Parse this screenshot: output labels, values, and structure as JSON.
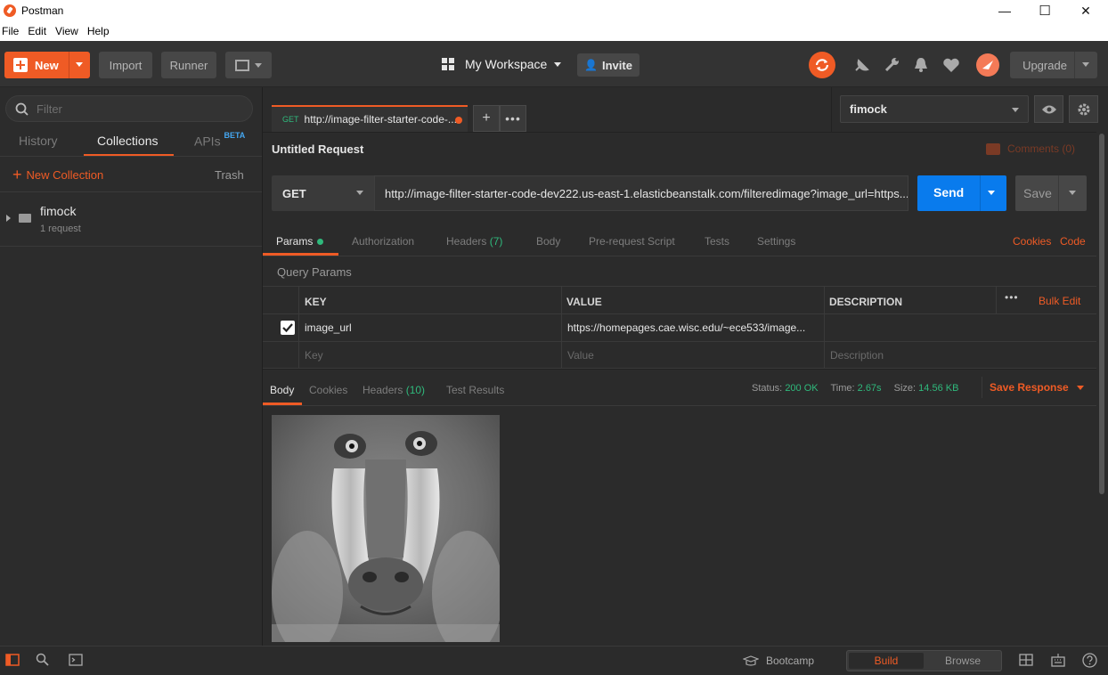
{
  "window": {
    "title": "Postman",
    "minimize": "—",
    "maximize": "☐",
    "close": "✕"
  },
  "menu": [
    "File",
    "Edit",
    "View",
    "Help"
  ],
  "header": {
    "new_label": "New",
    "import_label": "Import",
    "runner_label": "Runner",
    "workspace_label": "My Workspace",
    "invite_label": "Invite",
    "upgrade_label": "Upgrade"
  },
  "sidebar": {
    "filter_placeholder": "Filter",
    "tabs": {
      "history": "History",
      "collections": "Collections",
      "apis": "APIs",
      "apis_badge": "BETA"
    },
    "new_collection": "New Collection",
    "trash": "Trash",
    "collection": {
      "name": "fimock",
      "meta": "1 request"
    }
  },
  "request_tab": {
    "method": "GET",
    "label": "http://image-filter-starter-code-..."
  },
  "environment": {
    "selected": "fimock"
  },
  "request": {
    "name": "Untitled Request",
    "comments": "Comments (0)",
    "method": "GET",
    "url": "http://image-filter-starter-code-dev222.us-east-1.elasticbeanstalk.com/filteredimage?image_url=https...",
    "send": "Send",
    "save": "Save"
  },
  "req_tabs": {
    "params": "Params",
    "authorization": "Authorization",
    "headers": "Headers",
    "headers_count": "(7)",
    "body": "Body",
    "prerequest": "Pre-request Script",
    "tests": "Tests",
    "settings": "Settings",
    "cookies": "Cookies",
    "code": "Code"
  },
  "params": {
    "section_title": "Query Params",
    "columns": {
      "key": "KEY",
      "value": "VALUE",
      "description": "DESCRIPTION"
    },
    "bulk_edit": "Bulk Edit",
    "row": {
      "key": "image_url",
      "value": "https://homepages.cae.wisc.edu/~ece533/image..."
    },
    "placeholders": {
      "key": "Key",
      "value": "Value",
      "description": "Description"
    }
  },
  "response": {
    "tabs": {
      "body": "Body",
      "cookies": "Cookies",
      "headers": "Headers",
      "headers_count": "(10)",
      "tests": "Test Results"
    },
    "status_label": "Status:",
    "status_value": "200 OK",
    "time_label": "Time:",
    "time_value": "2.67s",
    "size_label": "Size:",
    "size_value": "14.56 KB",
    "save_response": "Save Response"
  },
  "statusbar": {
    "bootcamp": "Bootcamp",
    "build": "Build",
    "browse": "Browse"
  },
  "colors": {
    "accent": "#ef5b25",
    "send": "#097bed",
    "success": "#2fb97c"
  }
}
